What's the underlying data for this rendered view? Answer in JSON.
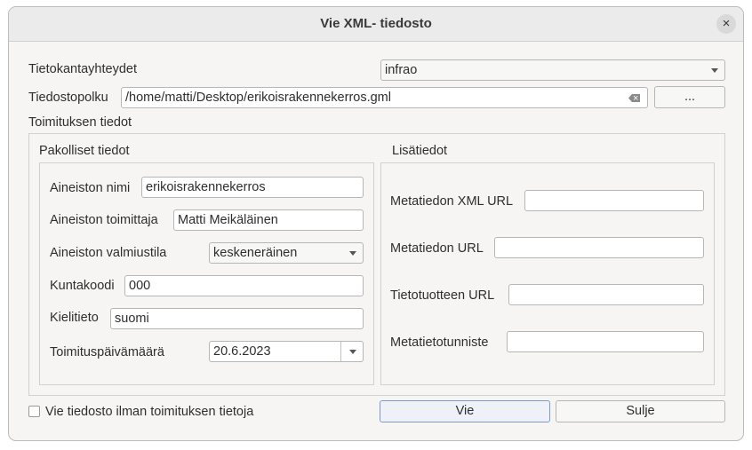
{
  "window": {
    "title": "Vie XML- tiedosto",
    "close_symbol": "×"
  },
  "connections": {
    "label": "Tietokantayhteydet",
    "value": "infrao"
  },
  "filepath": {
    "label": "Tiedostopolku",
    "value": "/home/matti/Desktop/erikoisrakennekerros.gml",
    "browse_label": "..."
  },
  "delivery": {
    "section_label": "Toimituksen tiedot",
    "required": {
      "title": "Pakolliset tiedot",
      "dataset_name": {
        "label": "Aineiston nimi",
        "value": "erikoisrakennekerros"
      },
      "supplier": {
        "label": "Aineiston toimittaja",
        "value": "Matti Meikäläinen"
      },
      "status": {
        "label": "Aineiston valmiustila",
        "value": "keskeneräinen"
      },
      "municipality": {
        "label": "Kuntakoodi",
        "value": "000"
      },
      "language": {
        "label": "Kielitieto",
        "value": "suomi"
      },
      "date": {
        "label": "Toimituspäivämäärä",
        "value": "20.6.2023"
      }
    },
    "additional": {
      "title": "Lisätiedot",
      "meta_xml_url": {
        "label": "Metatiedon XML URL",
        "value": ""
      },
      "meta_url": {
        "label": "Metatiedon URL",
        "value": ""
      },
      "product_url": {
        "label": "Tietotuotteen URL",
        "value": ""
      },
      "meta_id": {
        "label": "Metatietotunniste",
        "value": ""
      }
    }
  },
  "footer": {
    "export_without_label": "Vie tiedosto ilman toimituksen tietoja",
    "export_without_checked": false,
    "export_button": "Vie",
    "close_button": "Sulje"
  }
}
